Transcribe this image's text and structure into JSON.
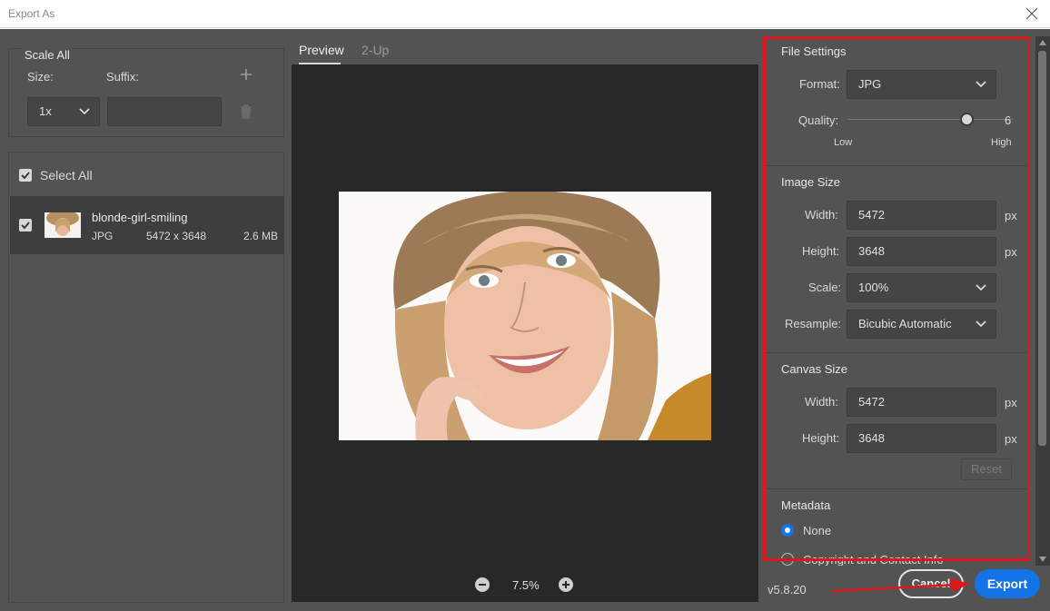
{
  "window": {
    "title": "Export As"
  },
  "scale_all": {
    "header": "Scale All",
    "size_label": "Size:",
    "suffix_label": "Suffix:",
    "size_value": "1x",
    "suffix_value": ""
  },
  "files": {
    "select_all_label": "Select All",
    "items": [
      {
        "name": "blonde-girl-smiling",
        "format": "JPG",
        "dimensions": "5472 x 3648",
        "size": "2.6 MB"
      }
    ]
  },
  "preview": {
    "tabs": [
      "Preview",
      "2-Up"
    ],
    "active_tab": "Preview",
    "zoom": "7.5%"
  },
  "file_settings": {
    "header": "File Settings",
    "format_label": "Format:",
    "format_value": "JPG",
    "quality_label": "Quality:",
    "quality_value": "6",
    "quality_low": "Low",
    "quality_high": "High",
    "quality_fraction": 0.78
  },
  "image_size": {
    "header": "Image Size",
    "width_label": "Width:",
    "width_value": "5472",
    "height_label": "Height:",
    "height_value": "3648",
    "scale_label": "Scale:",
    "scale_value": "100%",
    "resample_label": "Resample:",
    "resample_value": "Bicubic Automatic",
    "unit": "px"
  },
  "canvas_size": {
    "header": "Canvas Size",
    "width_label": "Width:",
    "width_value": "5472",
    "height_label": "Height:",
    "height_value": "3648",
    "unit": "px",
    "reset_label": "Reset"
  },
  "metadata": {
    "header": "Metadata",
    "options": [
      "None",
      "Copyright and Contact Info"
    ],
    "selected": "None"
  },
  "footer": {
    "version": "v5.8.20",
    "cancel_label": "Cancel",
    "export_label": "Export"
  },
  "colors": {
    "dialog_bg": "#535353",
    "canvas_bg": "#282828",
    "accent": "#1473e6",
    "highlight_box": "#e0161b"
  }
}
